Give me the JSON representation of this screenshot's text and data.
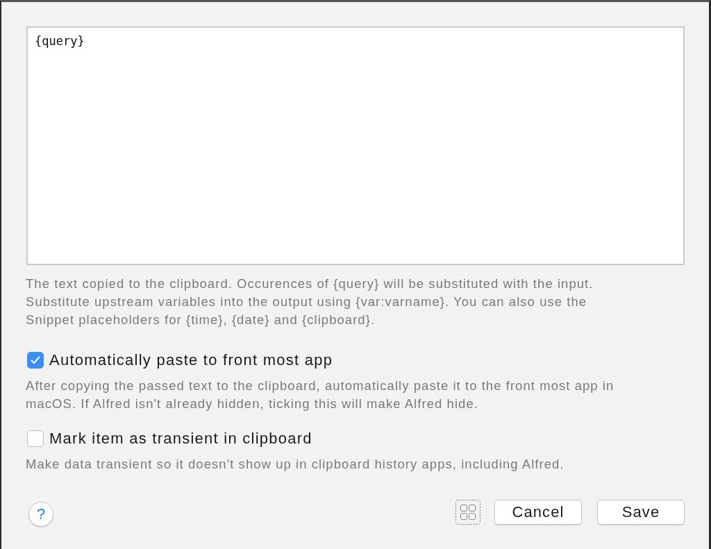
{
  "editor": {
    "value": "{query}"
  },
  "editor_help": "The text copied to the clipboard. Occurences of {query} will be substituted with the input. Substitute upstream variables into the output using {var:varname}. You can also use the Snippet placeholders for {time}, {date} and {clipboard}.",
  "options": [
    {
      "label": "Automatically paste to front most app",
      "checked": true,
      "description": "After copying the passed text to the clipboard, automatically paste it to the front most app in macOS. If Alfred isn't already hidden, ticking this will make Alfred hide."
    },
    {
      "label": "Mark item as transient in clipboard",
      "checked": false,
      "description": "Make data transient so it doesn't show up in clipboard history apps, including Alfred."
    }
  ],
  "help_button": {
    "label": "?"
  },
  "buttons": [
    {
      "label": "Cancel"
    },
    {
      "label": "Save"
    }
  ]
}
